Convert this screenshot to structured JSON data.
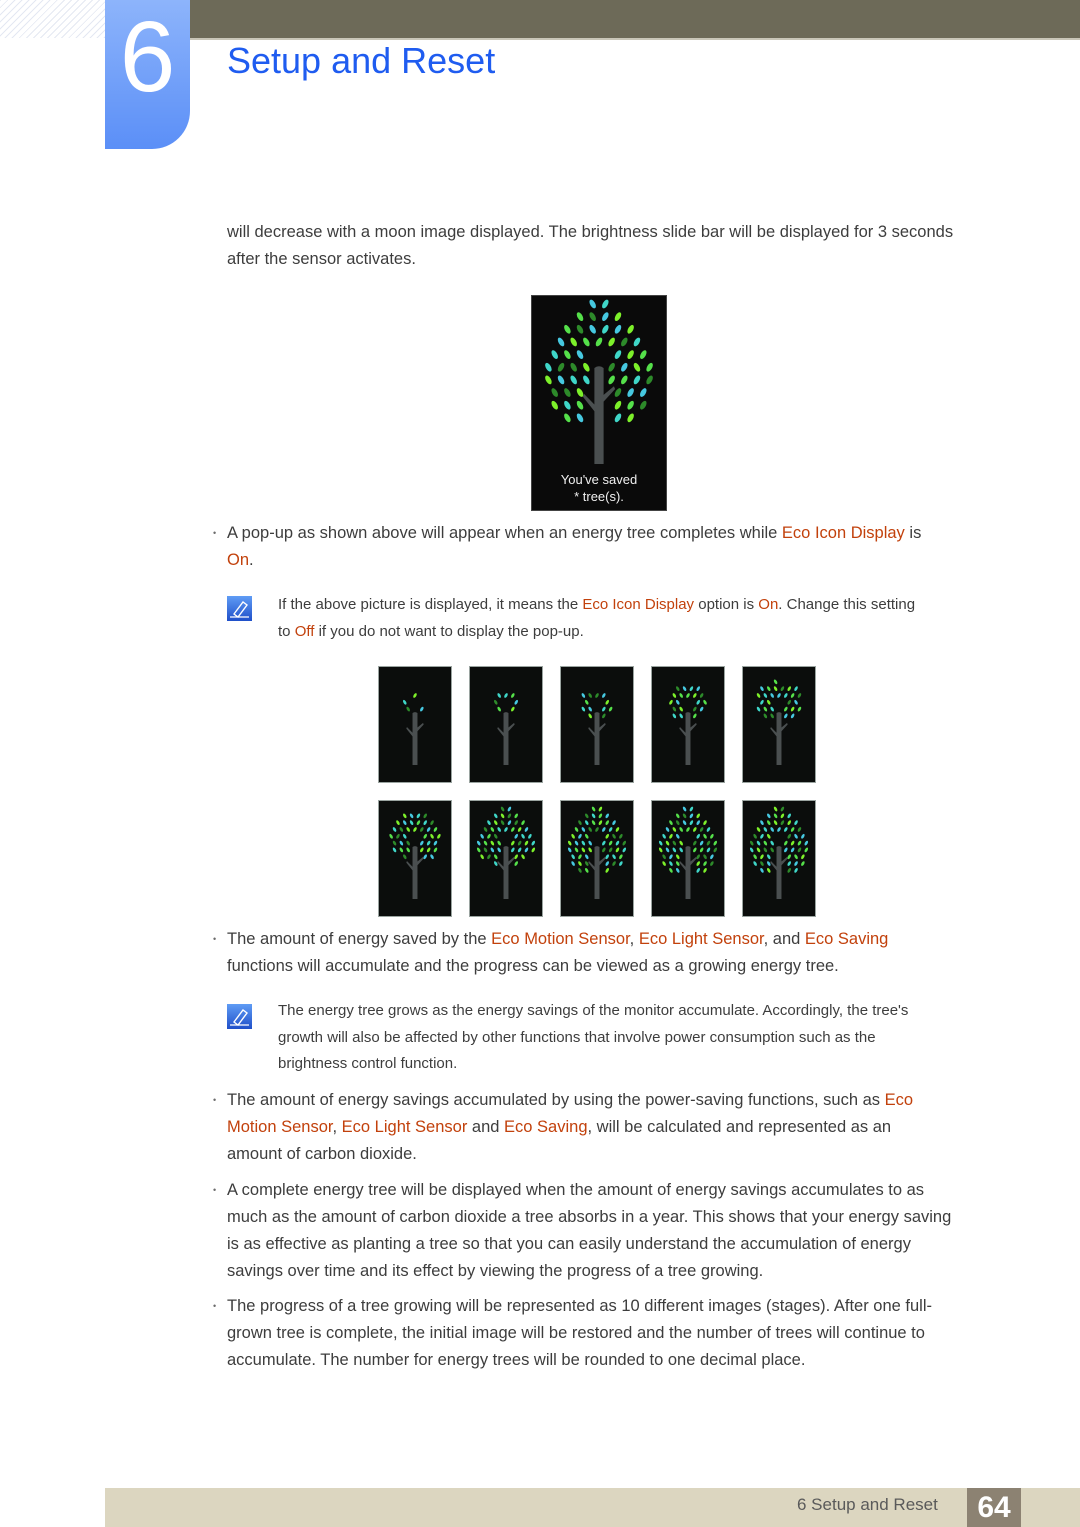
{
  "header": {
    "chapter_number": "6",
    "chapter_title": "Setup and Reset",
    "colors": {
      "accent_blue": "#1f5cf0",
      "topbar": "#6d6a58",
      "highlight": "#c2410c"
    }
  },
  "intro": {
    "line1": "will decrease with a moon image displayed. The brightness slide bar will be displayed for 3 seconds",
    "line2": "after the sensor activates."
  },
  "popup_image": {
    "line1": "You've saved",
    "line2": "* tree(s)."
  },
  "bullet1": {
    "t1": "A pop-up as shown above will appear when an energy tree completes while ",
    "h1": "Eco Icon Display",
    "t2": " is",
    "h2": "On",
    "t3": "."
  },
  "note1": {
    "t1": "If the above picture is displayed, it means the ",
    "h1": "Eco Icon Display",
    "t2": " option is ",
    "h2": "On",
    "t3": ". Change this setting",
    "t4": "to ",
    "h3": "Off",
    "t5": " if you do not want to display the pop-up."
  },
  "tree_stages": {
    "count": 10,
    "leaf_counts": [
      4,
      7,
      12,
      20,
      28,
      38,
      48,
      56,
      64,
      80
    ]
  },
  "bullet2": {
    "t1": "The amount of energy saved by the ",
    "h1": "Eco Motion Sensor",
    "t2": ", ",
    "h2": "Eco Light Sensor",
    "t3": ", and ",
    "h3": "Eco Saving",
    "t4": "functions will accumulate and the progress can be viewed as a growing energy tree."
  },
  "note2": {
    "line1": "The energy tree grows as the energy savings of the monitor accumulate. Accordingly, the tree's",
    "line2": "growth will also be affected by other functions that involve power consumption such as the",
    "line3": "brightness control function."
  },
  "bullet3": {
    "t1": "The amount of energy savings accumulated by using the power-saving functions, such as ",
    "h1a": "Eco",
    "h1b": "Motion Sensor",
    "t2": ", ",
    "h2": "Eco Light Sensor",
    "t3": " and ",
    "h3": "Eco Saving",
    "t4": ", will be calculated and represented as an",
    "t5": "amount of carbon dioxide."
  },
  "bullet4": {
    "line1": "A complete energy tree will be displayed when the amount of energy savings accumulates to as",
    "line2": "much as the amount of carbon dioxide a tree absorbs in a year. This shows that your energy saving",
    "line3": "is as effective as planting a tree so that you can easily understand the accumulation of energy",
    "line4": "savings over time and its effect by viewing the progress of a tree growing."
  },
  "bullet5": {
    "line1": "The progress of a tree growing will be represented as 10 different images (stages). After one full-",
    "line2": "grown tree is complete, the initial image will be restored and the number of trees will continue to",
    "line3": "accumulate. The number for energy trees will be rounded to one decimal place."
  },
  "footer": {
    "label": "6 Setup and Reset",
    "page_number": "64"
  },
  "icons": {
    "bullet": "•",
    "note": "note-pencil-icon"
  }
}
